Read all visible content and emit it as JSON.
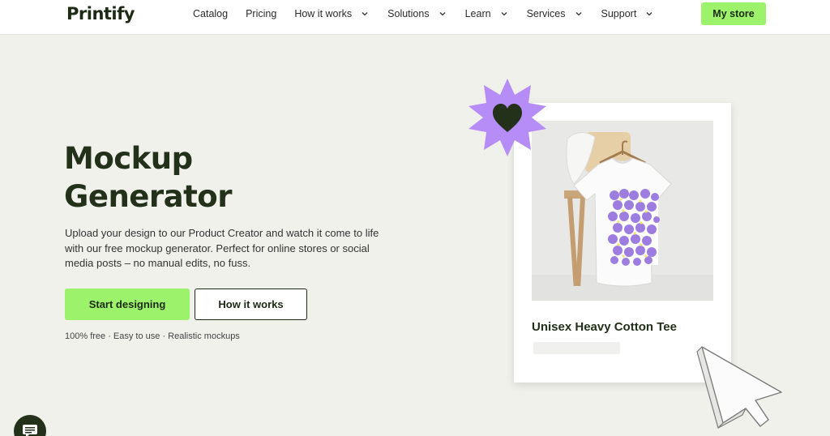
{
  "header": {
    "logo": "Printify",
    "nav": [
      {
        "label": "Catalog",
        "dropdown": false
      },
      {
        "label": "Pricing",
        "dropdown": false
      },
      {
        "label": "How it works",
        "dropdown": true
      },
      {
        "label": "Solutions",
        "dropdown": true
      },
      {
        "label": "Learn",
        "dropdown": true
      },
      {
        "label": "Services",
        "dropdown": true
      },
      {
        "label": "Support",
        "dropdown": true
      }
    ],
    "cta": "My store"
  },
  "hero": {
    "title_line1": "Mockup",
    "title_line2": "Generator",
    "description": "Upload your design to our Product Creator and watch it come to life with our free mockup generator. Perfect for online stores or social media posts – no manual edits, no fuss.",
    "primary_button": "Start designing",
    "secondary_button": "How it works",
    "features": "100% free · Easy to use · Realistic mockups"
  },
  "product_card": {
    "name": "Unisex Heavy Cotton Tee"
  },
  "icons": {
    "badge": "heart-icon",
    "cursor": "cursor-arrow-icon",
    "chat": "chat-icon"
  },
  "colors": {
    "accent": "#9cf26b",
    "dark": "#1d2a15",
    "badge": "#b68cf7",
    "background": "#f1f1ec"
  }
}
